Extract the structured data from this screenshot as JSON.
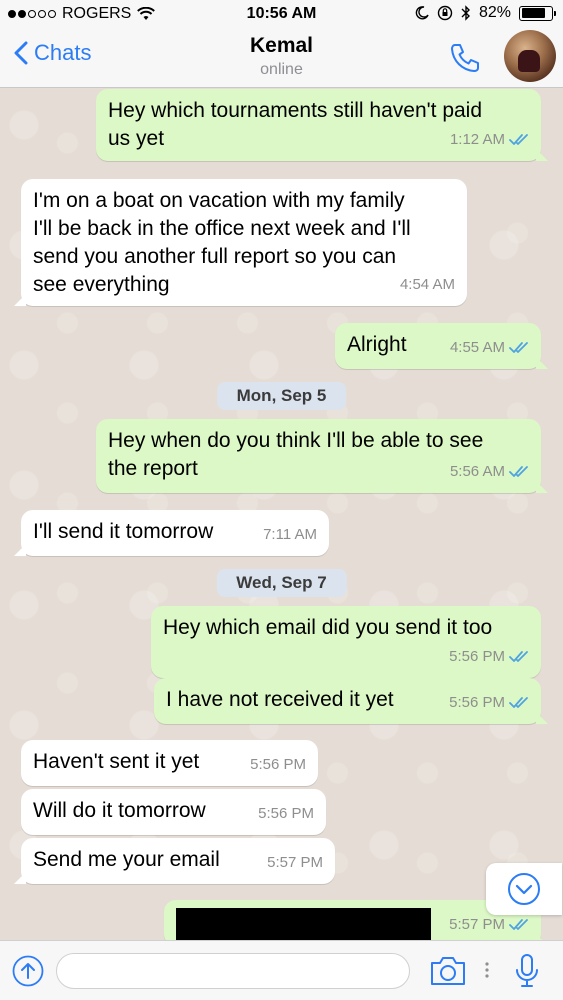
{
  "status_bar": {
    "carrier": "ROGERS",
    "time": "10:56 AM",
    "battery_percent": "82%",
    "battery_level": 0.82,
    "signal_bars_filled": 2,
    "signal_bars_total": 5
  },
  "header": {
    "back_label": "Chats",
    "contact_name": "Kemal",
    "contact_status": "online"
  },
  "colors": {
    "outgoing_bubble": "#dcf8c6",
    "incoming_bubble": "#ffffff",
    "accent": "#2c7cf6",
    "read_ticks": "#4fa3e0"
  },
  "messages": [
    {
      "direction": "out",
      "lines": [
        "Hey which tournaments still haven't paid",
        "us yet"
      ],
      "time": "1:12 AM",
      "read": true
    },
    {
      "direction": "in",
      "lines": [
        "I'm on a boat on vacation with my family",
        "I'll be back in the office next week and I'll",
        "send you another full report so you can",
        "see everything"
      ],
      "time": "4:54 AM"
    },
    {
      "direction": "out",
      "lines": [
        "Alright"
      ],
      "time": "4:55 AM",
      "read": true
    },
    {
      "direction": "date",
      "label": "Mon, Sep 5"
    },
    {
      "direction": "out",
      "lines": [
        "Hey when do you think I'll be able to see",
        "the report"
      ],
      "time": "5:56 AM",
      "read": true
    },
    {
      "direction": "in",
      "lines": [
        "I'll send it tomorrow"
      ],
      "time": "7:11 AM"
    },
    {
      "direction": "date",
      "label": "Wed, Sep 7"
    },
    {
      "direction": "out",
      "lines": [
        "Hey which email did you send it too"
      ],
      "time": "5:56 PM",
      "read": true
    },
    {
      "direction": "out",
      "lines": [
        "I have not received it yet"
      ],
      "time": "5:56 PM",
      "read": true
    },
    {
      "direction": "in",
      "lines": [
        "Haven't sent it yet"
      ],
      "time": "5:56 PM"
    },
    {
      "direction": "in",
      "lines": [
        "Will do it tomorrow"
      ],
      "time": "5:56 PM"
    },
    {
      "direction": "in",
      "lines": [
        "Send me your email"
      ],
      "time": "5:57 PM"
    },
    {
      "direction": "out",
      "lines": [],
      "redacted": true,
      "time": "5:57 PM",
      "read": true
    }
  ],
  "input": {
    "placeholder": "",
    "value": ""
  },
  "icons": {
    "back": "chevron-left-icon",
    "call": "phone-icon",
    "scroll_down": "chevron-down-circle-icon",
    "share": "share-up-arrow-icon",
    "camera": "camera-icon",
    "mic": "microphone-icon"
  }
}
